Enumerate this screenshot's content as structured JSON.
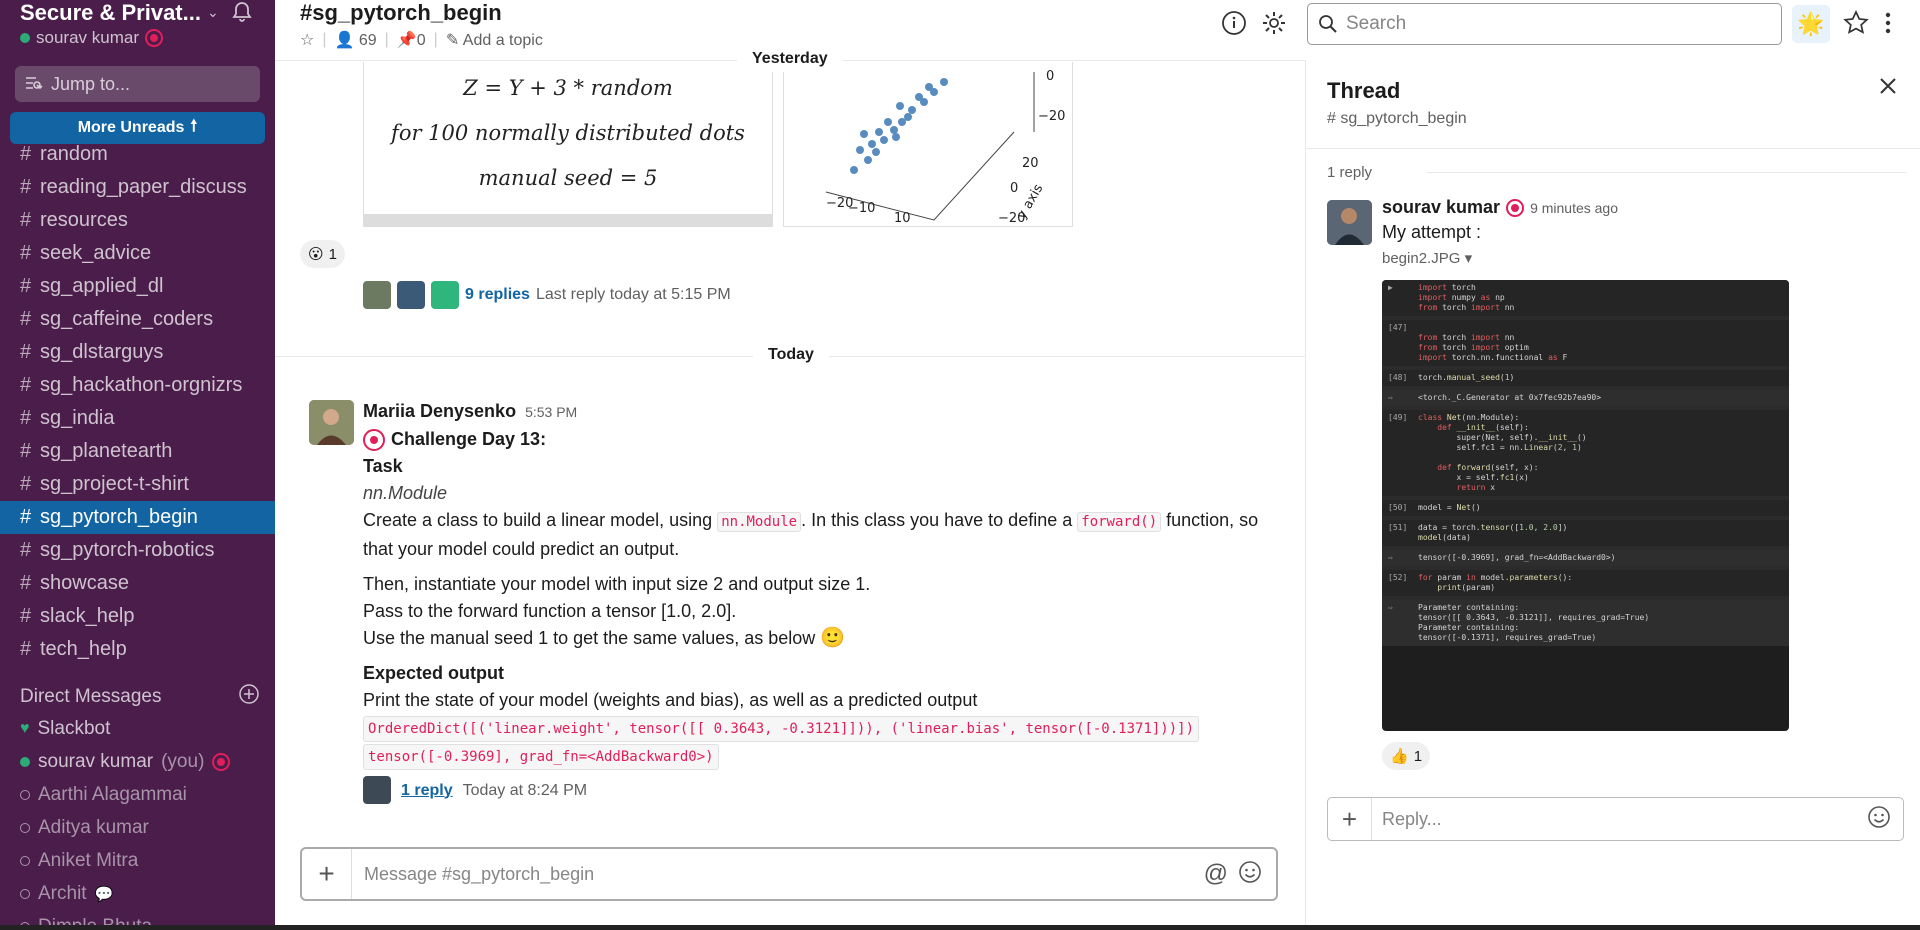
{
  "workspace": {
    "name": "Secure & Privat...",
    "user": "sourav kumar"
  },
  "sidebar": {
    "jump_placeholder": "Jump to...",
    "more_unreads": "More Unreads",
    "channels": [
      {
        "label": "random"
      },
      {
        "label": "reading_paper_discuss"
      },
      {
        "label": "resources"
      },
      {
        "label": "seek_advice"
      },
      {
        "label": "sg_applied_dl"
      },
      {
        "label": "sg_caffeine_coders"
      },
      {
        "label": "sg_dlstarguys"
      },
      {
        "label": "sg_hackathon-orgnizrs"
      },
      {
        "label": "sg_india"
      },
      {
        "label": "sg_planetearth"
      },
      {
        "label": "sg_project-t-shirt"
      },
      {
        "label": "sg_pytorch_begin",
        "active": true
      },
      {
        "label": "sg_pytorch-robotics"
      },
      {
        "label": "showcase"
      },
      {
        "label": "slack_help"
      },
      {
        "label": "tech_help"
      }
    ],
    "dm_header": "Direct Messages",
    "dms": [
      {
        "label": "Slackbot"
      },
      {
        "label": "sourav kumar",
        "suffix": "(you)"
      },
      {
        "label": "Aarthi Alagammai"
      },
      {
        "label": "Aditya kumar"
      },
      {
        "label": "Aniket Mitra"
      },
      {
        "label": "Archit"
      },
      {
        "label": "Dimple Bhuta"
      }
    ]
  },
  "channel": {
    "title": "#sg_pytorch_begin",
    "members": "69",
    "pins": "0",
    "add_topic": "Add a topic"
  },
  "search": {
    "placeholder": "Search"
  },
  "feed": {
    "yesterday_label": "Yesterday",
    "today_label": "Today",
    "image_equations": [
      "Z = Y + 3 * random",
      "for 100 normally distributed dots",
      "manual seed = 5"
    ],
    "prev_reaction_count": "1",
    "prev_replies": "9 replies",
    "prev_last_reply": "Last reply today at 5:15 PM",
    "message": {
      "author": "Mariia Denysenko",
      "time": "5:53 PM",
      "title": "Challenge Day 13:",
      "task": "Task",
      "module": "nn.Module",
      "p1_a": "Create a class to build a linear model, using",
      "p1_code1": "nn.Module",
      "p1_b": ". In this class you have to define a",
      "p1_code2": "forward()",
      "p1_c": "function, so that your model could predict an output.",
      "p2": "Then, instantiate your model with input size 2 and output size 1.",
      "p3": "Pass to the forward function a tensor [1.0, 2.0].",
      "p4": "Use the manual seed 1 to get the same values, as below",
      "expected": "Expected output",
      "p5": "Print the state of your model (weights and bias), as well as a predicted output",
      "code1": "OrderedDict([('linear.weight', tensor([[ 0.3643, -0.3121]])), ('linear.bias', tensor([-0.1371]))])",
      "code2": "tensor([-0.3969], grad_fn=<AddBackward0>)",
      "reply_count": "1 reply",
      "reply_time": "Today at 8:24 PM"
    }
  },
  "composer": {
    "placeholder": "Message #sg_pytorch_begin"
  },
  "thread": {
    "title": "Thread",
    "channel": "sg_pytorch_begin",
    "reply_count": "1 reply",
    "author": "sourav kumar",
    "time": "9 minutes ago",
    "text": "My attempt :",
    "file": "begin2.JPG",
    "reaction_count": "1",
    "reply_placeholder": "Reply..."
  },
  "colors": {
    "sidebar": "#4a1d4b",
    "active": "#1264a3",
    "link": "#1264a3",
    "code": "#e01e5a"
  }
}
